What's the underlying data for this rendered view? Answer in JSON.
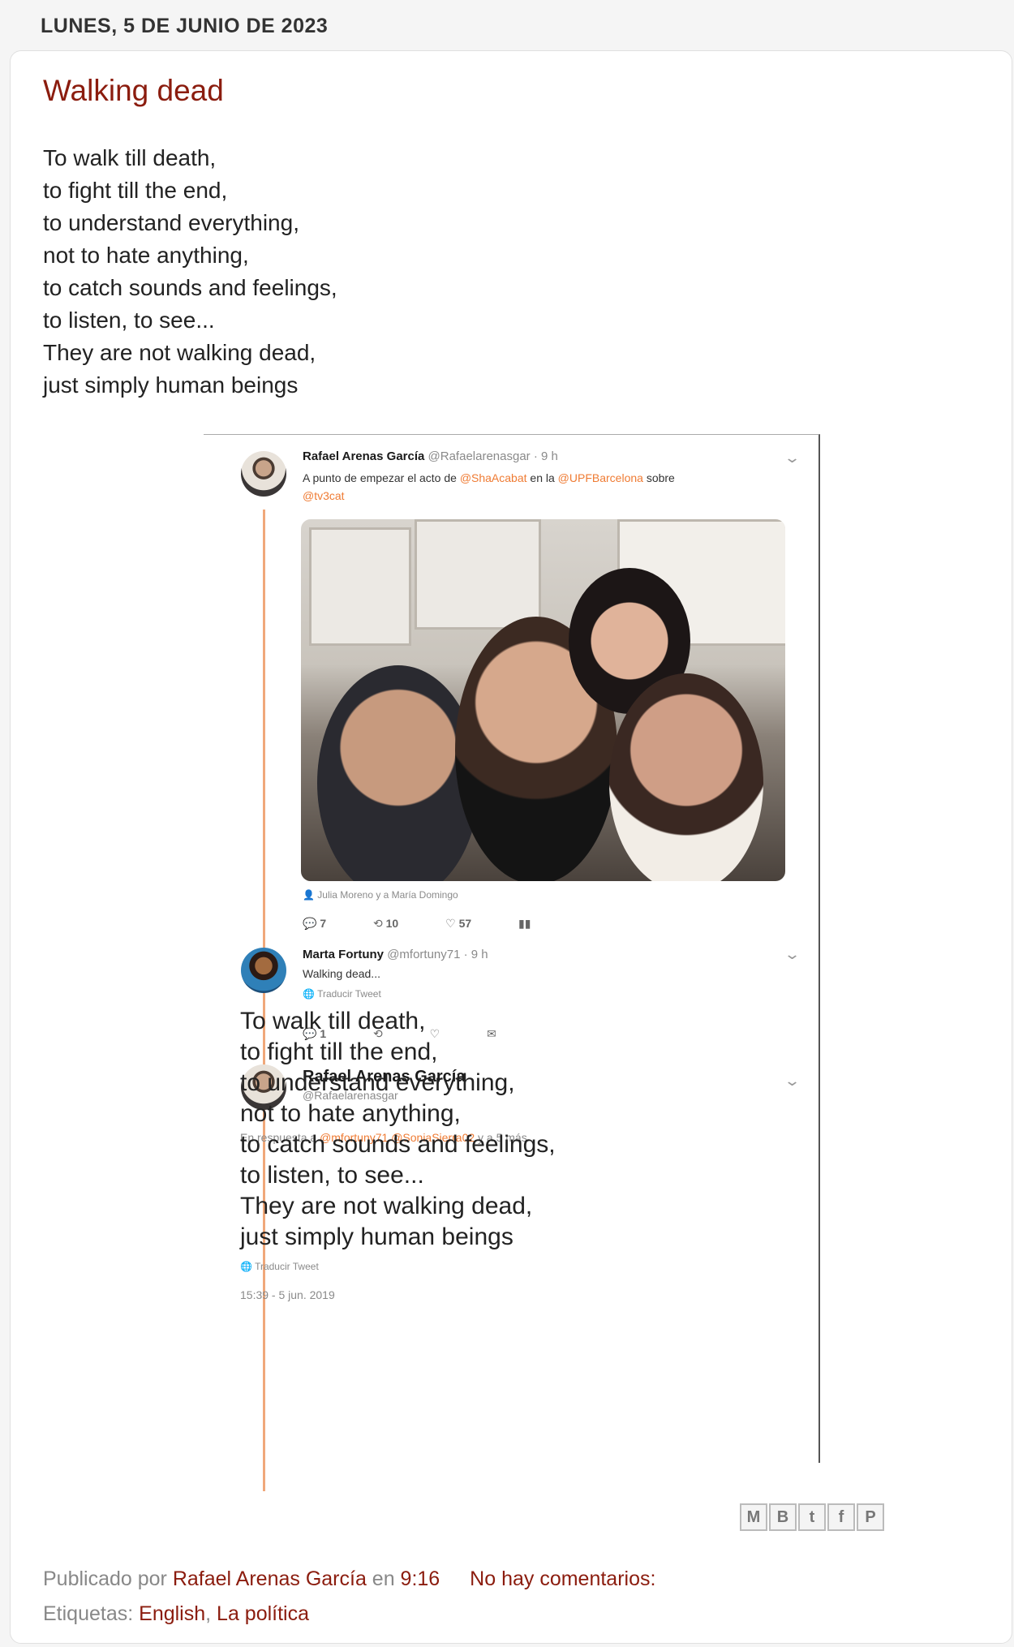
{
  "date_header": "LUNES, 5 DE JUNIO DE 2023",
  "post": {
    "title": "Walking dead",
    "poem": [
      "To walk till death,",
      "to fight till the end,",
      "to understand everything,",
      "not to hate anything,",
      "to catch sounds and feelings,",
      "to listen, to see...",
      "They are not walking dead,",
      "just simply human beings"
    ]
  },
  "tweet1": {
    "name": "Rafael Arenas García",
    "handle": "@Rafaelarenasgar · 9 h",
    "text_a": "A punto de empezar el acto de ",
    "mention1": "@ShaAcabat",
    "text_b": " en la ",
    "mention2": "@UPFBarcelona",
    "text_c": "  sobre",
    "mention3": "@tv3cat",
    "tagged": "Julia Moreno y a María Domingo",
    "replies": "7",
    "retweets": "10",
    "likes": "57"
  },
  "tweet2": {
    "name": "Marta Fortuny",
    "handle": "@mfortuny71 · 9 h",
    "text": "Walking dead...",
    "translate": "Traducir Tweet",
    "replies": "1"
  },
  "tweet3": {
    "name": "Rafael Arenas García",
    "handle": "@Rafaelarenasgar",
    "reply_to_prefix": "En respuesta a ",
    "reply_mention1": "@mfortuny71",
    "reply_mention2": "@SoniaSierra02",
    "reply_suffix": " y a 5 más",
    "translate": "Traducir Tweet",
    "timestamp": "15:39 - 5 jun. 2019"
  },
  "footer": {
    "published_by": "Publicado por ",
    "author": "Rafael Arenas García",
    "at": " en ",
    "time": "9:16",
    "comments": "No hay comentarios:",
    "tags_label": "Etiquetas: ",
    "tag1": "English",
    "tag2": "La política"
  },
  "share_icons": [
    "email-icon",
    "blogger-icon",
    "twitter-icon",
    "facebook-icon",
    "pinterest-icon"
  ]
}
